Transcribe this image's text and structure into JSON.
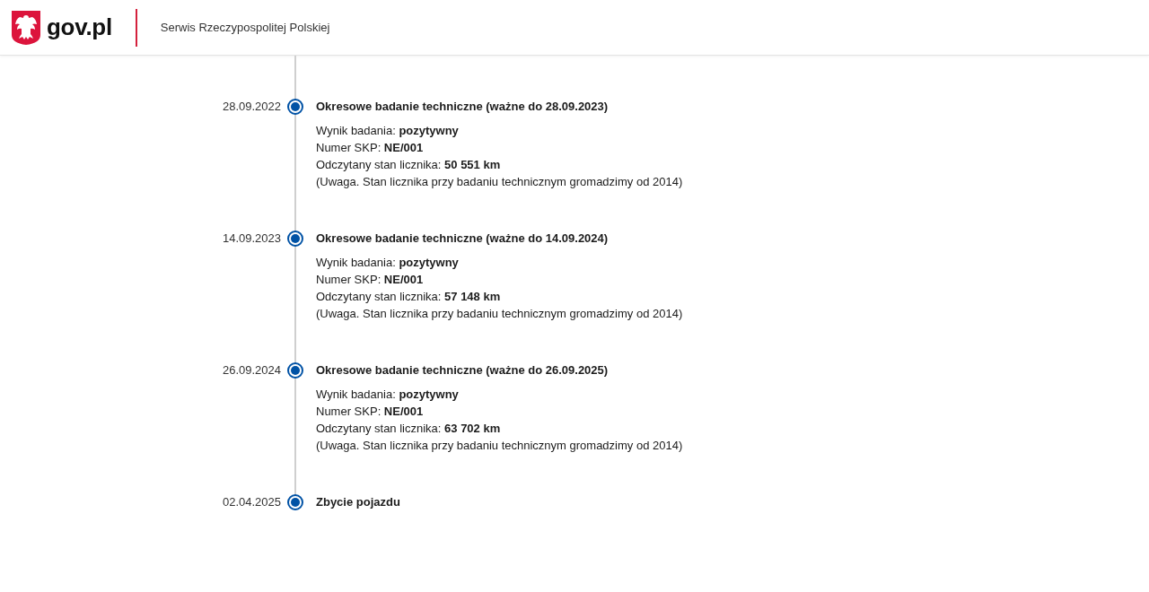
{
  "header": {
    "logo": "gov.pl",
    "service_name": "Serwis Rzeczypospolitej Polskiej"
  },
  "timeline": [
    {
      "date": "28.09.2022",
      "title": "Okresowe badanie techniczne (ważne do 28.09.2023)",
      "details": [
        {
          "label": "Wynik badania: ",
          "value": "pozytywny"
        },
        {
          "label": "Numer SKP: ",
          "value": "NE/001"
        },
        {
          "label": "Odczytany stan licznika: ",
          "value": "50 551 km"
        }
      ],
      "note": "(Uwaga. Stan licznika przy badaniu technicznym gromadzimy od 2014)"
    },
    {
      "date": "14.09.2023",
      "title": "Okresowe badanie techniczne (ważne do 14.09.2024)",
      "details": [
        {
          "label": "Wynik badania: ",
          "value": "pozytywny"
        },
        {
          "label": "Numer SKP: ",
          "value": "NE/001"
        },
        {
          "label": "Odczytany stan licznika: ",
          "value": "57 148 km"
        }
      ],
      "note": "(Uwaga. Stan licznika przy badaniu technicznym gromadzimy od 2014)"
    },
    {
      "date": "26.09.2024",
      "title": "Okresowe badanie techniczne (ważne do 26.09.2025)",
      "details": [
        {
          "label": "Wynik badania: ",
          "value": "pozytywny"
        },
        {
          "label": "Numer SKP: ",
          "value": "NE/001"
        },
        {
          "label": "Odczytany stan licznika: ",
          "value": "63 702 km"
        }
      ],
      "note": "(Uwaga. Stan licznika przy badaniu technicznym gromadzimy od 2014)"
    },
    {
      "date": "02.04.2025",
      "title": "Zbycie pojazdu"
    }
  ]
}
